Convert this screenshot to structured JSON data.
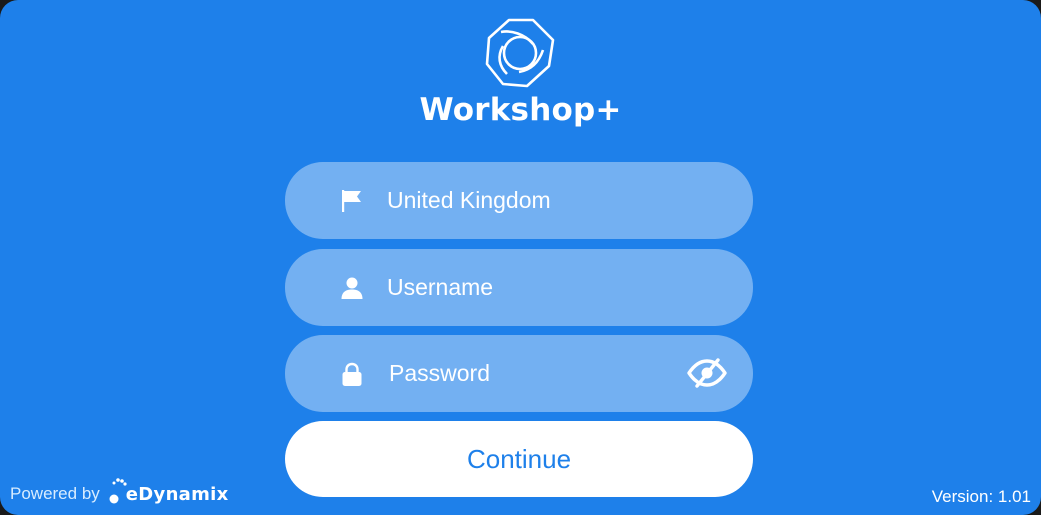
{
  "app": {
    "title": "Workshop+",
    "logo_icon": "hexagon-aperture-logo-icon"
  },
  "form": {
    "country": {
      "value": "United Kingdom",
      "icon": "flag-icon"
    },
    "username": {
      "placeholder": "Username",
      "icon": "user-icon"
    },
    "password": {
      "placeholder": "Password",
      "icon": "lock-icon",
      "toggle_icon": "eye-off-icon"
    },
    "continue_label": "Continue"
  },
  "footer": {
    "powered_by": "Powered by",
    "brand": "eDynamix",
    "version": "Version: 1.01"
  },
  "colors": {
    "background": "#1e80ea",
    "field": "#7aaef2",
    "button": "#ffffff",
    "button_text": "#1e80ea"
  }
}
